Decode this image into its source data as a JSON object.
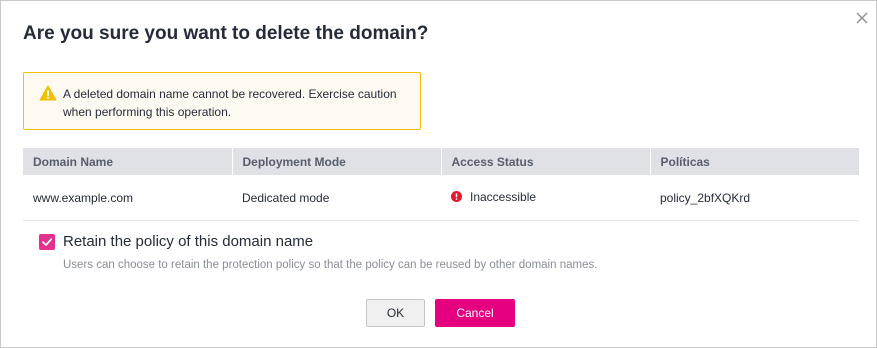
{
  "dialog": {
    "title": "Are you sure you want to delete the domain?"
  },
  "alert": {
    "icon": "warning-icon",
    "color": "#f0c000",
    "text": "A deleted domain name cannot be recovered. Exercise caution when performing this operation."
  },
  "table": {
    "headers": [
      "Domain Name",
      "Deployment Mode",
      "Access Status",
      "Políticas"
    ],
    "rows": [
      {
        "domain": "www.example.com",
        "mode": "Dedicated mode",
        "status": "Inaccessible",
        "status_color": "#e5182d",
        "policy": "policy_2bfXQKrd"
      }
    ]
  },
  "retain": {
    "checked": true,
    "label": "Retain the policy of this domain name",
    "description": "Users can choose to retain the protection policy so that the policy can be reused by other domain names."
  },
  "buttons": {
    "ok": "OK",
    "cancel": "Cancel"
  },
  "colors": {
    "accent": "#e4007f",
    "checkbox": "#e6318c"
  }
}
